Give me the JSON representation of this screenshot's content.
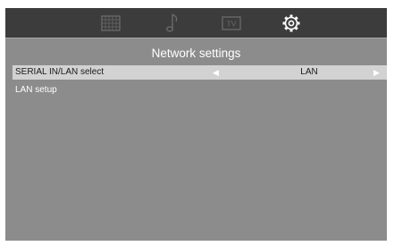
{
  "top_icons": [
    {
      "icon": "picture-grid-icon",
      "active": false
    },
    {
      "icon": "music-note-icon",
      "active": false
    },
    {
      "icon": "tv-icon",
      "active": false,
      "text": "TV"
    },
    {
      "icon": "settings-gear-icon",
      "active": true
    }
  ],
  "colors": {
    "screen": "#8c8c8c",
    "topbar": "#3c3c3c",
    "highlight": "#d2d2d2"
  },
  "menu": {
    "title": "Network settings",
    "items": [
      {
        "label": "SERIAL IN/LAN select",
        "value": "LAN",
        "prev_arrow": "◀",
        "next_arrow": "▶"
      },
      {
        "label": "LAN setup"
      }
    ]
  }
}
